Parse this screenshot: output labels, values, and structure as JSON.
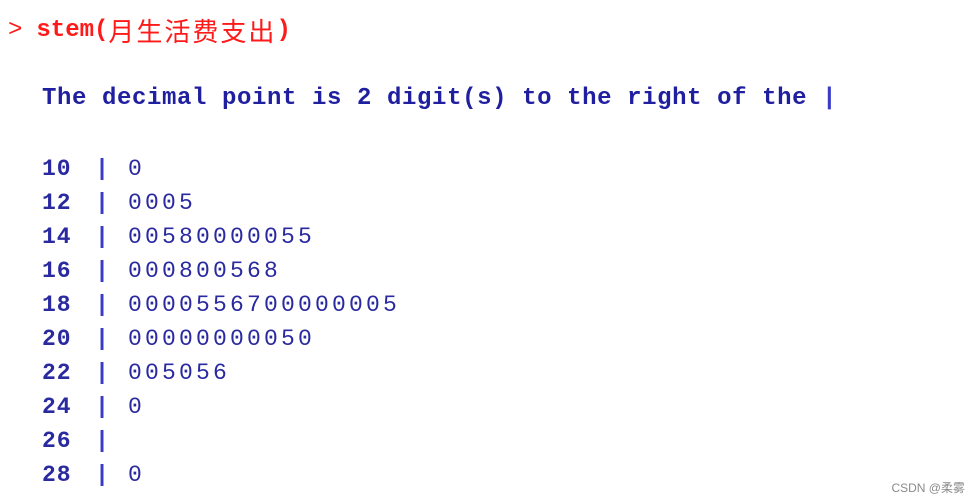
{
  "console": {
    "prompt": ">",
    "command": {
      "function": "stem",
      "open_paren": "(",
      "argument": "月生活费支出",
      "close_paren": ")"
    },
    "command_color": "#ff1a1a",
    "output_color": "#1f1f9f",
    "decimal_note": {
      "text": "The decimal point is 2 digit(s) to the right of the ",
      "bar": "|"
    },
    "separator": "|",
    "rows": [
      {
        "stem": "10",
        "leaves": "0"
      },
      {
        "stem": "12",
        "leaves": "0005"
      },
      {
        "stem": "14",
        "leaves": "00580000055"
      },
      {
        "stem": "16",
        "leaves": "000800568"
      },
      {
        "stem": "18",
        "leaves": "0000556700000005"
      },
      {
        "stem": "20",
        "leaves": "00000000050"
      },
      {
        "stem": "22",
        "leaves": "005056"
      },
      {
        "stem": "24",
        "leaves": "0"
      },
      {
        "stem": "26",
        "leaves": ""
      },
      {
        "stem": "28",
        "leaves": "0"
      }
    ]
  },
  "watermark": "CSDN @柔雾"
}
